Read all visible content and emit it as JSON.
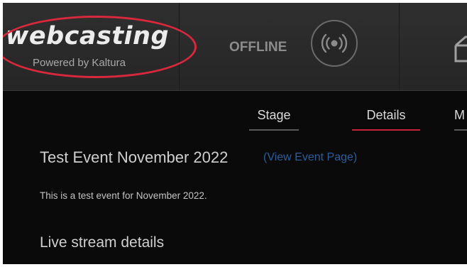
{
  "header": {
    "logo_text": "webcasting",
    "logo_subtitle": "Powered by Kaltura",
    "status_label": "OFFLINE",
    "broadcast_icon": "broadcast-icon",
    "third_icon": "box-icon",
    "colors": {
      "highlight_ring": "#d8283c",
      "bar_background": "#2b2b2b"
    }
  },
  "tabs": [
    {
      "label": "Stage",
      "active": false
    },
    {
      "label": "Details",
      "active": true
    },
    {
      "label": "M",
      "active": false
    }
  ],
  "details": {
    "event_title": "Test Event November 2022",
    "event_link_label": "(View Event Page)",
    "description": "This is a test event for November 2022.",
    "section_heading": "Live stream details"
  },
  "colors": {
    "active_tab": "#c6243a",
    "link": "#2c5d9c",
    "content_background": "#0a0a0a"
  }
}
